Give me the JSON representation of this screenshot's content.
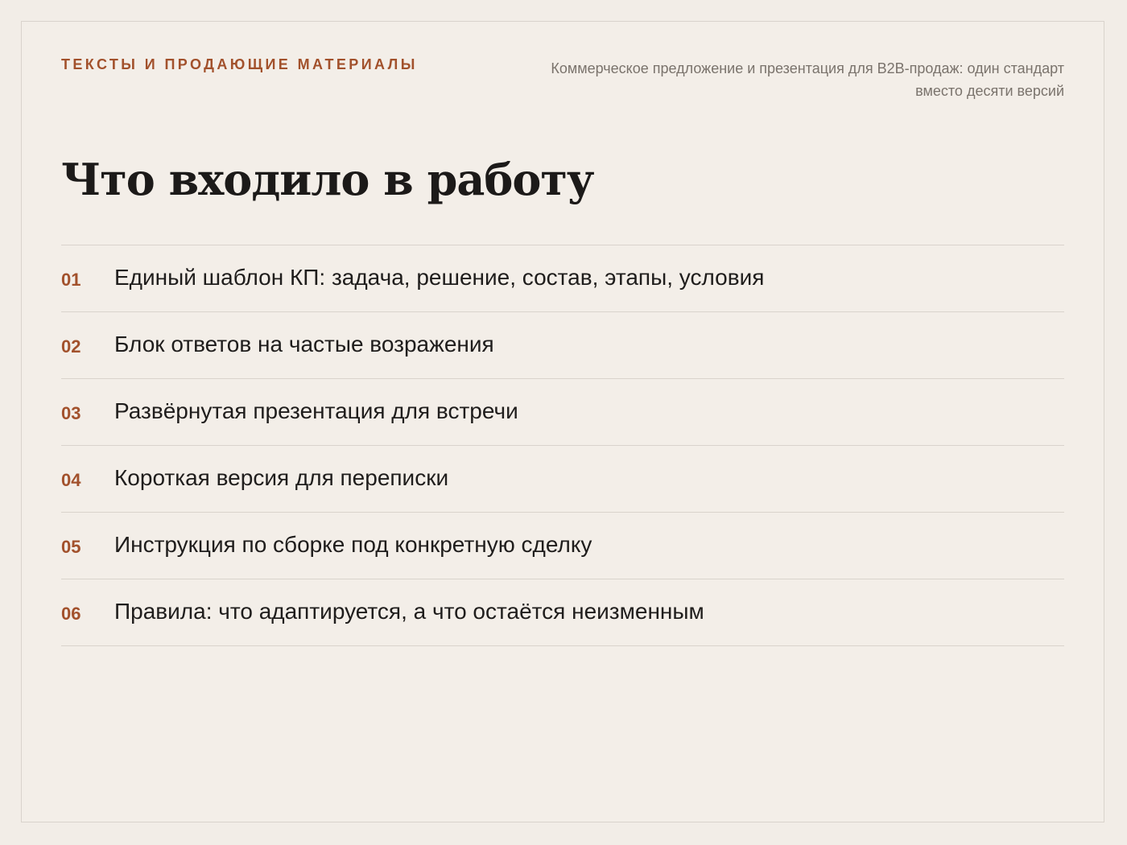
{
  "header": {
    "eyebrow": "Тексты и продающие материалы",
    "subtitle": "Коммерческое предложение и презентация для B2B-продаж: один стандарт вместо десяти версий"
  },
  "title": "Что входило в работу",
  "items": [
    {
      "number": "01",
      "text": "Единый шаблон КП: задача, решение, состав, этапы, условия"
    },
    {
      "number": "02",
      "text": "Блок ответов на частые возражения"
    },
    {
      "number": "03",
      "text": "Развёрнутая презентация для встречи"
    },
    {
      "number": "04",
      "text": "Короткая версия для переписки"
    },
    {
      "number": "05",
      "text": "Инструкция по сборке под конкретную сделку"
    },
    {
      "number": "06",
      "text": "Правила: что адаптируется, а что остаётся неизменным"
    }
  ],
  "colors": {
    "background": "#f2ede7",
    "accent": "#a2512c",
    "text": "#1f1d1c",
    "muted": "#7a736c",
    "divider": "#d9d3cc"
  }
}
